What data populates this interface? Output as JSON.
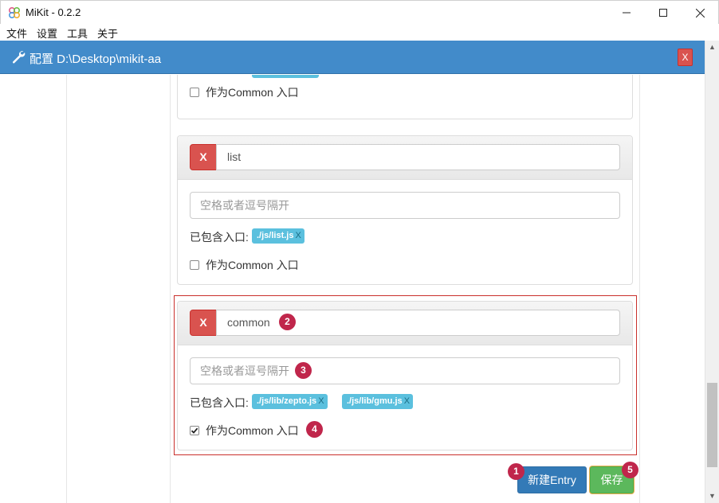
{
  "window": {
    "title": "MiKit - 0.2.2",
    "controls": {
      "minimize": "—",
      "maximize": "☐",
      "close": "✕"
    }
  },
  "menu": [
    "文件",
    "设置",
    "工具",
    "关于"
  ],
  "header": {
    "title": "配置 D:\\Desktop\\mikit-aa",
    "close_label": "X",
    "bg_color": "#428bca"
  },
  "entries": [
    {
      "common_label": "作为Common 入口",
      "is_common": false
    },
    {
      "delete_label": "X",
      "name": "list",
      "input_placeholder": "空格或者逗号隔开",
      "contains_label": "已包含入口:",
      "tags": [
        {
          "text": "./js/list.js",
          "remove": "X"
        }
      ],
      "common_label": "作为Common 入口",
      "is_common": false
    },
    {
      "delete_label": "X",
      "name": "common",
      "input_placeholder": "空格或者逗号隔开",
      "contains_label": "已包含入口:",
      "tags": [
        {
          "text": "./js/lib/zepto.js",
          "remove": "X"
        },
        {
          "text": "./js/lib/gmu.js",
          "remove": "X"
        }
      ],
      "common_label": "作为Common 入口",
      "is_common": true
    }
  ],
  "buttons": {
    "new_entry": "新建Entry",
    "save": "保存"
  },
  "badges": [
    "1",
    "2",
    "3",
    "4",
    "5"
  ],
  "colors": {
    "danger": "#d9534f",
    "info_tag": "#5bc0de",
    "primary": "#337ab7",
    "success": "#5cb85c",
    "badge": "#c0264b"
  }
}
